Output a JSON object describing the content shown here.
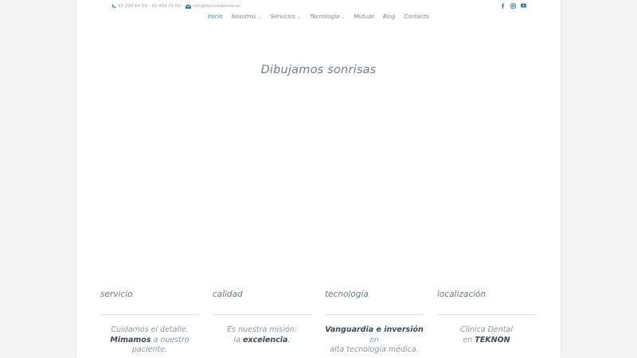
{
  "topbar": {
    "phone": "93 290 64 54 - 93 434 01 00",
    "email": "info@teknondental.es"
  },
  "social": [
    "facebook-icon",
    "instagram-icon",
    "youtube-icon"
  ],
  "nav": {
    "items": [
      {
        "label": "Inicio",
        "active": true,
        "dropdown": false
      },
      {
        "label": "Nosotros",
        "active": false,
        "dropdown": true
      },
      {
        "label": "Servicios",
        "active": false,
        "dropdown": true
      },
      {
        "label": "Tecnología",
        "active": false,
        "dropdown": true
      },
      {
        "label": "Mutuas",
        "active": false,
        "dropdown": false
      },
      {
        "label": "Blog",
        "active": false,
        "dropdown": false
      },
      {
        "label": "Contacto",
        "active": false,
        "dropdown": false
      }
    ],
    "chevron": "⌄"
  },
  "hero": {
    "title": "Dibujamos sonrisas"
  },
  "columns": [
    {
      "title": "servicio",
      "l1a": "Cuidamos el detalle.",
      "l2b": "Mimamos",
      "l2c": " a nuestro",
      "l3": "paciente."
    },
    {
      "title": "calidad",
      "l1a": "Es nuestra misión:",
      "l2a": "la ",
      "l2b": "excelencia",
      "l2c": "."
    },
    {
      "title": "tecnología",
      "l1b": "Vanguardia e inversión",
      "l1c": " en",
      "l2a": "alta tecnología médica."
    },
    {
      "title": "localización",
      "l1a": "Clínica Dental",
      "l2a": "en ",
      "l2b": "TEKNON"
    }
  ],
  "colors": {
    "accent": "#2e7bb2",
    "text": "#8a96a0",
    "background": "#f4f4f4"
  }
}
